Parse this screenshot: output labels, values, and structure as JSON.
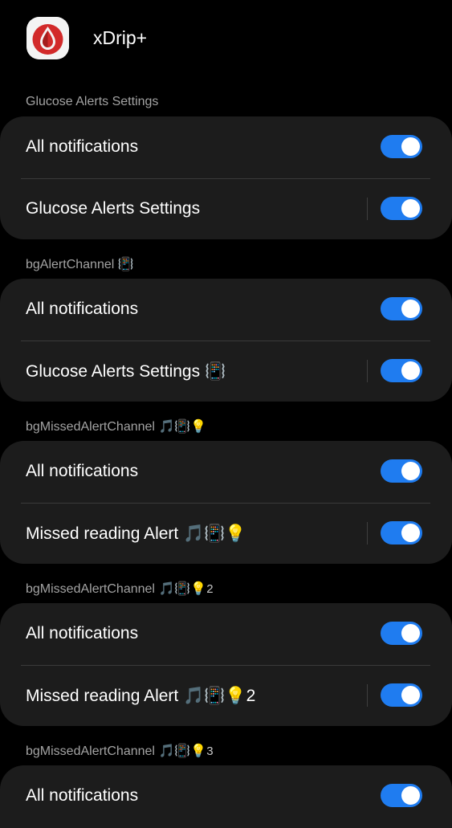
{
  "header": {
    "app_name": "xDrip+",
    "icon": "xdrip-blood-drop-icon",
    "icon_colors": {
      "background": "#f4f4f4",
      "drop": "#d22a2a"
    }
  },
  "accent_color": "#1f7cf0",
  "sections": [
    {
      "title": "Glucose Alerts Settings",
      "title_emojis": "",
      "title_suffix": "",
      "rows": [
        {
          "label": "All notifications",
          "emojis": "",
          "suffix": "",
          "enabled": true
        },
        {
          "label": "Glucose Alerts Settings",
          "emojis": "",
          "suffix": "",
          "enabled": true
        }
      ]
    },
    {
      "title": "bgAlertChannel",
      "title_emojis": "📳",
      "title_suffix": "",
      "rows": [
        {
          "label": "All notifications",
          "emojis": "",
          "suffix": "",
          "enabled": true
        },
        {
          "label": "Glucose Alerts Settings",
          "emojis": "📳",
          "suffix": "",
          "enabled": true
        }
      ]
    },
    {
      "title": "bgMissedAlertChannel",
      "title_emojis": "🎵📳💡",
      "title_suffix": "",
      "rows": [
        {
          "label": "All notifications",
          "emojis": "",
          "suffix": "",
          "enabled": true
        },
        {
          "label": "Missed reading Alert",
          "emojis": "🎵📳💡",
          "suffix": "",
          "enabled": true
        }
      ]
    },
    {
      "title": "bgMissedAlertChannel",
      "title_emojis": "🎵📳💡",
      "title_suffix": "2",
      "rows": [
        {
          "label": "All notifications",
          "emojis": "",
          "suffix": "",
          "enabled": true
        },
        {
          "label": "Missed reading Alert",
          "emojis": "🎵📳💡",
          "suffix": "2",
          "enabled": true
        }
      ]
    },
    {
      "title": "bgMissedAlertChannel",
      "title_emojis": "🎵📳💡",
      "title_suffix": "3",
      "rows": [
        {
          "label": "All notifications",
          "emojis": "",
          "suffix": "",
          "enabled": true
        }
      ]
    }
  ]
}
